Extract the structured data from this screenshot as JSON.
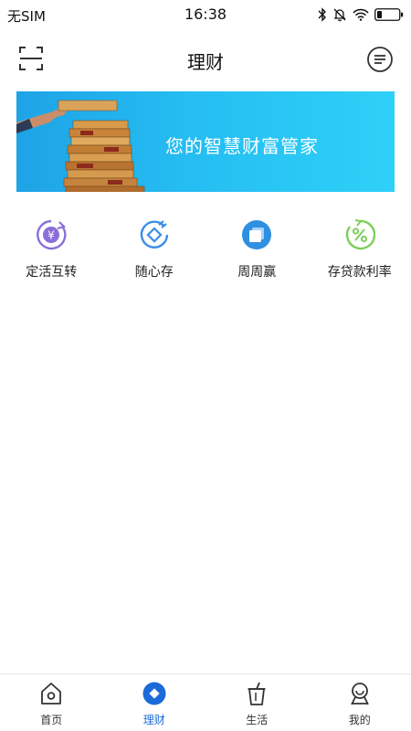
{
  "status_bar": {
    "carrier": "无SIM",
    "time": "16:38"
  },
  "nav": {
    "title": "理财",
    "left_icon": "scan-icon",
    "right_icon": "message-icon"
  },
  "banner": {
    "text": "您的智慧财富管家",
    "colors": {
      "start": "#1ea3e6",
      "end": "#2fd0f8"
    }
  },
  "quick_entries": [
    {
      "label": "定活互转",
      "icon": "yuan-cycle-icon",
      "color": "#8b6fd8"
    },
    {
      "label": "随心存",
      "icon": "deposit-icon",
      "color": "#3a8ee6"
    },
    {
      "label": "周周赢",
      "icon": "weekly-win-icon",
      "color": "#2f8fe0"
    },
    {
      "label": "存贷款利率",
      "icon": "percent-icon",
      "color": "#7ccf5a"
    }
  ],
  "tab_bar": {
    "tabs": [
      {
        "label": "首页",
        "icon": "home-icon",
        "active": false
      },
      {
        "label": "理财",
        "icon": "finance-icon",
        "active": true
      },
      {
        "label": "生活",
        "icon": "cup-icon",
        "active": false
      },
      {
        "label": "我的",
        "icon": "profile-icon",
        "active": false
      }
    ],
    "active_color": "#1a6ad8"
  }
}
